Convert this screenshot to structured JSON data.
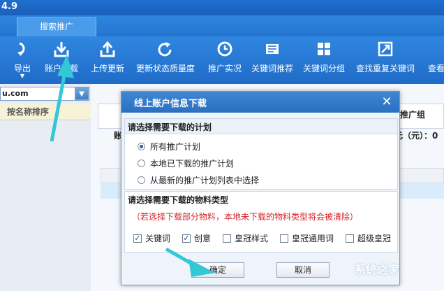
{
  "window": {
    "title": "4.9"
  },
  "tabs": [
    {
      "label": "搜索推广"
    }
  ],
  "toolbar": [
    {
      "label": "导出",
      "icon": "export-icon"
    },
    {
      "label": "账户下载",
      "icon": "download-icon"
    },
    {
      "label": "上传更新",
      "icon": "upload-icon"
    },
    {
      "label": "更新状态质量度",
      "icon": "refresh-icon"
    },
    {
      "label": "推广实况",
      "icon": "clock-icon"
    },
    {
      "label": "关键词推荐",
      "icon": "keyword-recommend-icon"
    },
    {
      "label": "关键词分组",
      "icon": "grid-icon"
    },
    {
      "label": "查找重复关键词",
      "icon": "find-duplicate-icon"
    },
    {
      "label": "查看",
      "icon": "view-icon"
    }
  ],
  "left": {
    "combo_value": "u.com",
    "sort_header": "按名称排序"
  },
  "grid": {
    "header_right": "推广组",
    "row_left": "账",
    "row_right": "元（元）：0"
  },
  "dialog": {
    "title": "线上账户信息下载",
    "plan_section": "请选择需要下载的计划",
    "plan_options": [
      {
        "label": "所有推广计划",
        "checked": true
      },
      {
        "label": "本地已下载的推广计划",
        "checked": false
      },
      {
        "label": "从最新的推广计划列表中选择",
        "checked": false
      }
    ],
    "material_section": "请选择需要下载的物料类型",
    "warning": "（若选择下载部分物料，本地未下载的物料类型将会被清除）",
    "materials": [
      {
        "label": "关键词",
        "checked": true
      },
      {
        "label": "创意",
        "checked": true
      },
      {
        "label": "皇冠样式",
        "checked": false
      },
      {
        "label": "皇冠通用词",
        "checked": false
      },
      {
        "label": "超级皇冠",
        "checked": false
      }
    ],
    "ok": "确定",
    "cancel": "取消"
  },
  "watermark": "系统之家",
  "colors": {
    "toolbar": "#2474cf",
    "arrow": "#32c8d6",
    "warning": "#d6232b"
  }
}
